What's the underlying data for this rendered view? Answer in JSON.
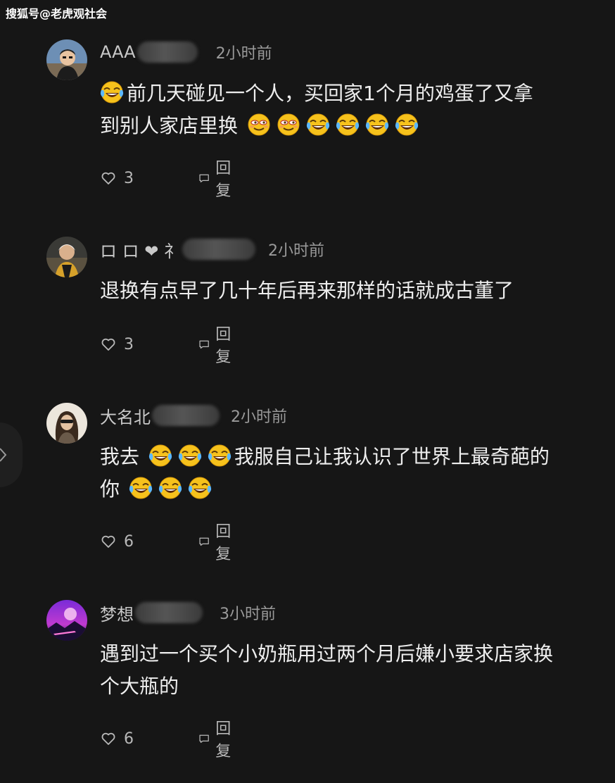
{
  "watermark": "搜狐号@老虎观社会",
  "reply_label": "回复",
  "comments": [
    {
      "username": "AAA",
      "time": "2小时前",
      "text_parts": [
        "前几天碰见一个人，买回家1个月的鸡蛋了又拿",
        "到别人家店里换"
      ],
      "likes": "3",
      "avatar_icon": "user-avatar-man-icon"
    },
    {
      "username": "ロ ロ ❤ 礻",
      "time": "2小时前",
      "text": "退换有点早了几十年后再来那样的话就成古董了",
      "likes": "3",
      "avatar_icon": "user-avatar-child-icon"
    },
    {
      "username": "大名北",
      "time": "2小时前",
      "text_parts": [
        "我去",
        "我服自己让我认识了世界上最奇葩的",
        "你"
      ],
      "likes": "6",
      "avatar_icon": "user-avatar-woman-icon"
    },
    {
      "username": "梦想",
      "time": "3小时前",
      "text": "遇到过一个买个小奶瓶用过两个月后嫌小要求店家换个大瓶的",
      "likes": "6",
      "avatar_icon": "user-avatar-landscape-icon"
    }
  ],
  "colors": {
    "background": "#161616",
    "text": "#eeeeee",
    "meta": "#9a9a9a",
    "emoji_yellow": "#f6c21c"
  }
}
